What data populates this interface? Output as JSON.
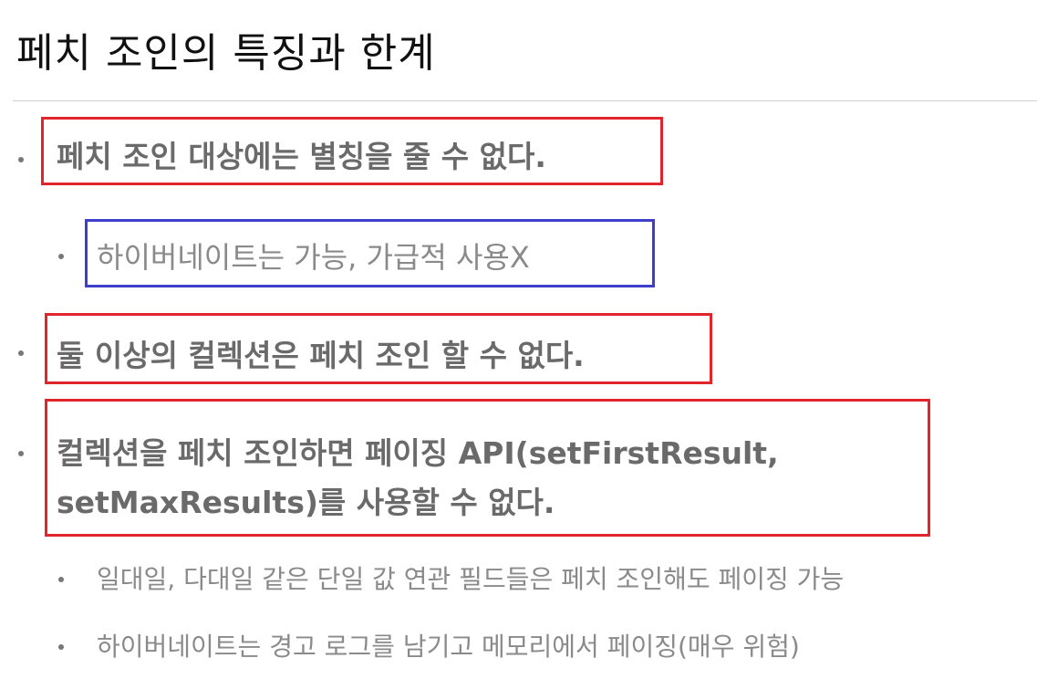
{
  "title": "페치 조인의 특징과 한계",
  "items": [
    {
      "text": "페치 조인 대상에는 별칭을 줄 수 없다."
    },
    {
      "text": "하이버네이트는 가능, 가급적 사용X"
    },
    {
      "text": "둘 이상의 컬렉션은 페치 조인 할 수 없다."
    },
    {
      "line1": "컬렉션을 페치 조인하면 페이징 API(setFirstResult,",
      "line2": "setMaxResults)를 사용할 수 없다."
    },
    {
      "text": "일대일, 다대일 같은 단일 값 연관 필드들은 페치 조인해도 페이징 가능"
    },
    {
      "text": "하이버네이트는 경고 로그를 남기고 메모리에서 페이징(매우 위험)"
    }
  ],
  "colors": {
    "highlight_red": "#e0262c",
    "highlight_blue": "#3b3fcb"
  }
}
